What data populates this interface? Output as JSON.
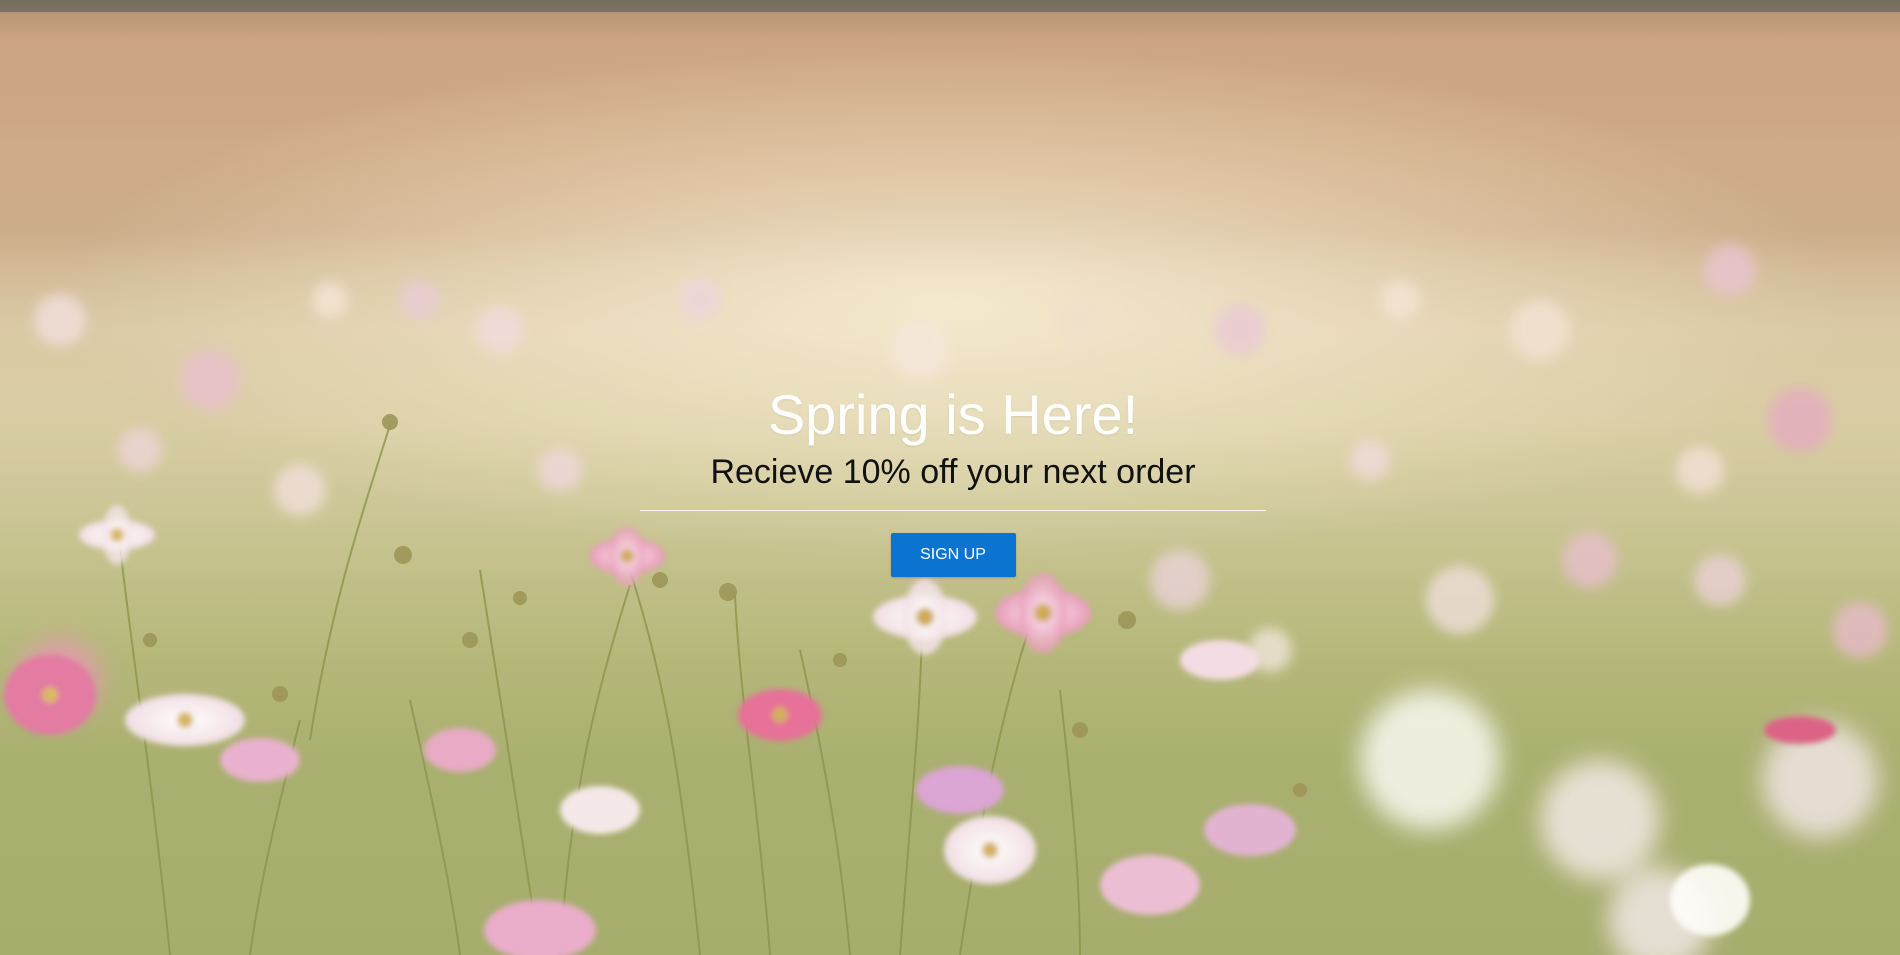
{
  "hero": {
    "headline": "Spring is Here!",
    "subheadline": "Recieve 10% off your next order",
    "cta_label": "SIGN UP"
  },
  "colors": {
    "cta_background": "#0b74d1",
    "headline_text": "#ffffff",
    "subheadline_text": "#111111"
  }
}
